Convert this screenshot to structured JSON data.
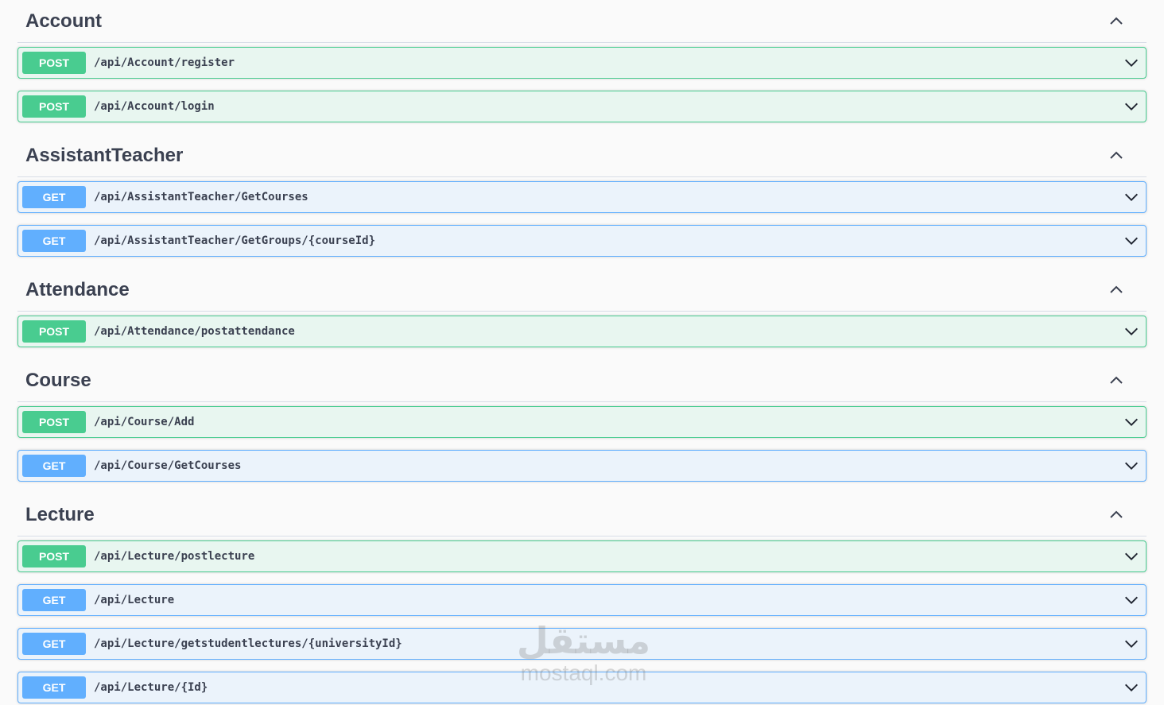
{
  "sections": [
    {
      "title": "Account",
      "operations": [
        {
          "method": "POST",
          "path": "/api/Account/register"
        },
        {
          "method": "POST",
          "path": "/api/Account/login"
        }
      ]
    },
    {
      "title": "AssistantTeacher",
      "operations": [
        {
          "method": "GET",
          "path": "/api/AssistantTeacher/GetCourses"
        },
        {
          "method": "GET",
          "path": "/api/AssistantTeacher/GetGroups/{courseId}"
        }
      ]
    },
    {
      "title": "Attendance",
      "operations": [
        {
          "method": "POST",
          "path": "/api/Attendance/postattendance"
        }
      ]
    },
    {
      "title": "Course",
      "operations": [
        {
          "method": "POST",
          "path": "/api/Course/Add"
        },
        {
          "method": "GET",
          "path": "/api/Course/GetCourses"
        }
      ]
    },
    {
      "title": "Lecture",
      "operations": [
        {
          "method": "POST",
          "path": "/api/Lecture/postlecture"
        },
        {
          "method": "GET",
          "path": "/api/Lecture"
        },
        {
          "method": "GET",
          "path": "/api/Lecture/getstudentlectures/{universityId}"
        },
        {
          "method": "GET",
          "path": "/api/Lecture/{Id}"
        }
      ]
    }
  ],
  "watermark": {
    "arabic": "مستقل",
    "latin": "mostaql.com"
  },
  "colors": {
    "post": "#49cc90",
    "get": "#61affe",
    "post_bg": "#e8f6f0",
    "get_bg": "#ebf3fb"
  },
  "icons": {
    "section_toggle": "chevron-up-icon",
    "operation_toggle": "chevron-down-icon"
  }
}
